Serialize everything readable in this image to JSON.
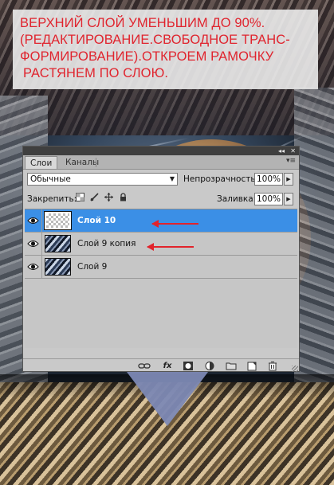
{
  "caption": {
    "line1": "ВЕРХНИЙ СЛОЙ УМЕНЬШИМ ДО 90%.",
    "line2": "(РЕДАКТИРОВАНИЕ.СВОБОДНОЕ ТРАНС-",
    "line3": "ФОРМИРОВАНИЕ).ОТКРОЕМ РАМОЧКУ",
    "line4": "РАСТЯНЕМ ПО СЛОЮ."
  },
  "panel": {
    "controls": {
      "collapse": "◂◂",
      "close": "✕",
      "menu": "▾≡"
    },
    "tabs": [
      {
        "label": "Слои"
      },
      {
        "label": "Каналы"
      }
    ],
    "blend_mode": "Обычные",
    "opacity_label": "Непрозрачность:",
    "opacity_value": "100%",
    "lock_label": "Закрепить:",
    "fill_label": "Заливка:",
    "fill_value": "100%",
    "layers": [
      {
        "name": "Слой 10",
        "selected": true,
        "visible": true,
        "thumbnail": "transparent-checker"
      },
      {
        "name": "Слой 9 копия",
        "selected": false,
        "visible": true,
        "thumbnail": "image"
      },
      {
        "name": "Слой 9",
        "selected": false,
        "visible": true,
        "thumbnail": "image"
      }
    ],
    "bottom_icons": [
      "link-icon",
      "fx-icon",
      "mask-icon",
      "adjustment-icon",
      "folder-icon",
      "new-layer-icon",
      "trash-icon"
    ],
    "fx_label": "fx"
  },
  "colors": {
    "caption_text": "#e0242e",
    "selection": "#3b8fe6",
    "arrow": "#e2232b"
  }
}
